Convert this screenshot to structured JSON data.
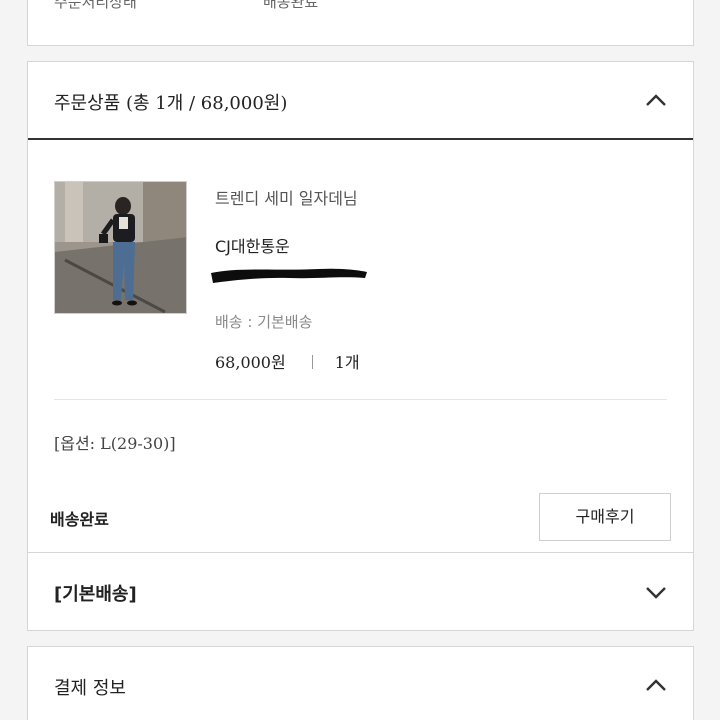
{
  "status": {
    "label": "주문처리상태",
    "value": "배송완료"
  },
  "order_section": {
    "title": "주문상품 (총 1개 / 68,000원)",
    "expanded": true
  },
  "product": {
    "name": "트렌디 세미 일자데님",
    "courier": "CJ대한통운",
    "shipping": "배송 : 기본배송",
    "price": "68,000원",
    "quantity": "1개",
    "option": "[옵션: L(29-30)]",
    "delivery_status": "배송완료",
    "review_button": "구매후기",
    "tracking_number_redacted": true
  },
  "shipping_section": {
    "title": "[기본배송]",
    "expanded": false
  },
  "payment_section": {
    "title": "결제 정보",
    "expanded": true
  },
  "icons": {
    "collapse": "chevron-up-icon",
    "expand": "chevron-down-icon"
  },
  "colors": {
    "border": "#d6d6d6",
    "header_rule": "#333333",
    "muted_text": "#8a8a8a"
  }
}
